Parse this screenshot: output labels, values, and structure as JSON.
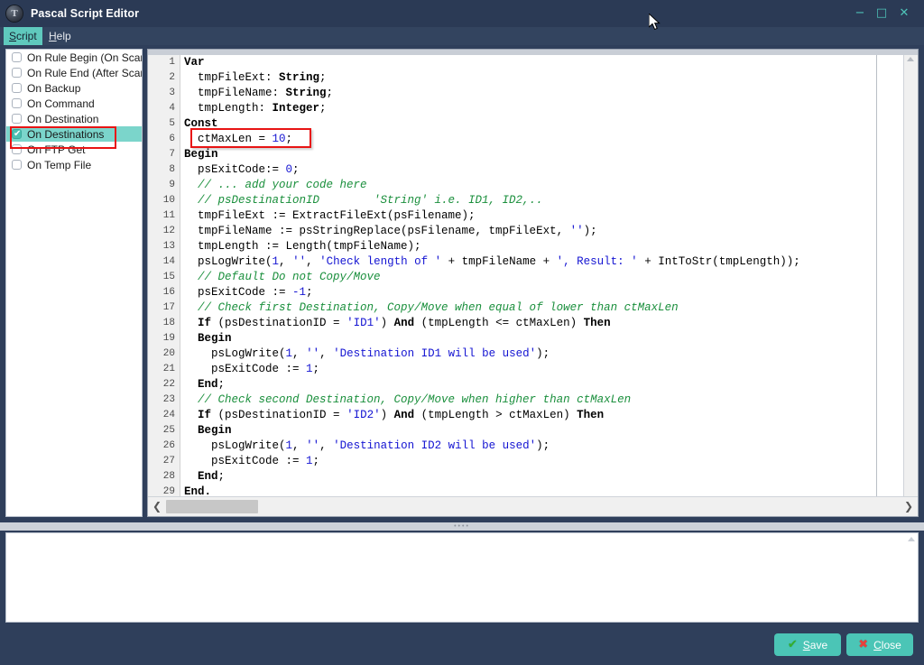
{
  "window": {
    "title": "Pascal Script Editor",
    "icon": "app-logo-icon",
    "minimize": "−",
    "maximize": "□",
    "close": "✕"
  },
  "menubar": {
    "items": [
      {
        "label": "Script",
        "accel": "S",
        "rest": "cript",
        "active": true
      },
      {
        "label": "Help",
        "accel": "H",
        "rest": "elp",
        "active": false
      }
    ]
  },
  "sidebar": {
    "items": [
      {
        "label": "On Rule Begin (On Scan)",
        "checked": false,
        "selected": false
      },
      {
        "label": "On Rule End (After Scan)",
        "checked": false,
        "selected": false
      },
      {
        "label": "On Backup",
        "checked": false,
        "selected": false
      },
      {
        "label": "On Command",
        "checked": false,
        "selected": false
      },
      {
        "label": "On Destination",
        "checked": false,
        "selected": false
      },
      {
        "label": "On Destinations",
        "checked": true,
        "selected": true
      },
      {
        "label": "On FTP Get",
        "checked": false,
        "selected": false
      },
      {
        "label": "On Temp File",
        "checked": false,
        "selected": false
      }
    ],
    "check_glyph": "✔"
  },
  "editor": {
    "line_numbers": [
      1,
      2,
      3,
      4,
      5,
      6,
      7,
      8,
      9,
      10,
      11,
      12,
      13,
      14,
      15,
      16,
      17,
      18,
      19,
      20,
      21,
      22,
      23,
      24,
      25,
      26,
      27,
      28,
      29
    ],
    "lines": [
      [
        {
          "t": "Var",
          "c": "kw"
        }
      ],
      [
        {
          "t": "  tmpFileExt: ",
          "c": "id"
        },
        {
          "t": "String",
          "c": "kw"
        },
        {
          "t": ";",
          "c": "op"
        }
      ],
      [
        {
          "t": "  tmpFileName: ",
          "c": "id"
        },
        {
          "t": "String",
          "c": "kw"
        },
        {
          "t": ";",
          "c": "op"
        }
      ],
      [
        {
          "t": "  tmpLength: ",
          "c": "id"
        },
        {
          "t": "Integer",
          "c": "kw"
        },
        {
          "t": ";",
          "c": "op"
        }
      ],
      [
        {
          "t": "Const",
          "c": "kw"
        }
      ],
      [
        {
          "t": "  ctMaxLen = ",
          "c": "id"
        },
        {
          "t": "10",
          "c": "num"
        },
        {
          "t": ";",
          "c": "op"
        }
      ],
      [
        {
          "t": "Begin",
          "c": "kw"
        }
      ],
      [
        {
          "t": "  psExitCode:= ",
          "c": "id"
        },
        {
          "t": "0",
          "c": "num"
        },
        {
          "t": ";",
          "c": "op"
        }
      ],
      [
        {
          "t": "  // ... add your code here",
          "c": "cmt"
        }
      ],
      [
        {
          "t": "  // psDestinationID        'String' i.e. ID1, ID2,..",
          "c": "cmt"
        }
      ],
      [
        {
          "t": "  tmpFileExt := ExtractFileExt(psFilename);",
          "c": "id"
        }
      ],
      [
        {
          "t": "  tmpFileName := psStringReplace(psFilename, tmpFileExt, ",
          "c": "id"
        },
        {
          "t": "''",
          "c": "str"
        },
        {
          "t": ");",
          "c": "op"
        }
      ],
      [
        {
          "t": "  tmpLength := Length(tmpFileName);",
          "c": "id"
        }
      ],
      [
        {
          "t": "  psLogWrite(",
          "c": "id"
        },
        {
          "t": "1",
          "c": "num"
        },
        {
          "t": ", ",
          "c": "op"
        },
        {
          "t": "''",
          "c": "str"
        },
        {
          "t": ", ",
          "c": "op"
        },
        {
          "t": "'Check length of '",
          "c": "str"
        },
        {
          "t": " + ",
          "c": "op"
        },
        {
          "t": "tmpFileName",
          "c": "id"
        },
        {
          "t": " + ",
          "c": "op"
        },
        {
          "t": "', Result: '",
          "c": "str"
        },
        {
          "t": " + ",
          "c": "op"
        },
        {
          "t": "IntToStr(tmpLength));",
          "c": "id"
        }
      ],
      [
        {
          "t": "  // Default Do not Copy/Move",
          "c": "cmt"
        }
      ],
      [
        {
          "t": "  psExitCode := ",
          "c": "id"
        },
        {
          "t": "-1",
          "c": "num"
        },
        {
          "t": ";",
          "c": "op"
        }
      ],
      [
        {
          "t": "  // Check first Destination, Copy/Move when equal of lower than ctMaxLen",
          "c": "cmt"
        }
      ],
      [
        {
          "t": "  ",
          "c": "op"
        },
        {
          "t": "If",
          "c": "kw"
        },
        {
          "t": " (psDestinationID = ",
          "c": "id"
        },
        {
          "t": "'ID1'",
          "c": "str"
        },
        {
          "t": ") ",
          "c": "op"
        },
        {
          "t": "And",
          "c": "kw"
        },
        {
          "t": " (tmpLength <= ctMaxLen) ",
          "c": "id"
        },
        {
          "t": "Then",
          "c": "kw"
        }
      ],
      [
        {
          "t": "  ",
          "c": "op"
        },
        {
          "t": "Begin",
          "c": "kw"
        }
      ],
      [
        {
          "t": "    psLogWrite(",
          "c": "id"
        },
        {
          "t": "1",
          "c": "num"
        },
        {
          "t": ", ",
          "c": "op"
        },
        {
          "t": "''",
          "c": "str"
        },
        {
          "t": ", ",
          "c": "op"
        },
        {
          "t": "'Destination ID1 will be used'",
          "c": "str"
        },
        {
          "t": ");",
          "c": "op"
        }
      ],
      [
        {
          "t": "    psExitCode := ",
          "c": "id"
        },
        {
          "t": "1",
          "c": "num"
        },
        {
          "t": ";",
          "c": "op"
        }
      ],
      [
        {
          "t": "  ",
          "c": "op"
        },
        {
          "t": "End",
          "c": "kw"
        },
        {
          "t": ";",
          "c": "op"
        }
      ],
      [
        {
          "t": "  // Check second Destination, Copy/Move when higher than ctMaxLen",
          "c": "cmt"
        }
      ],
      [
        {
          "t": "  ",
          "c": "op"
        },
        {
          "t": "If",
          "c": "kw"
        },
        {
          "t": " (psDestinationID = ",
          "c": "id"
        },
        {
          "t": "'ID2'",
          "c": "str"
        },
        {
          "t": ") ",
          "c": "op"
        },
        {
          "t": "And",
          "c": "kw"
        },
        {
          "t": " (tmpLength > ctMaxLen) ",
          "c": "id"
        },
        {
          "t": "Then",
          "c": "kw"
        }
      ],
      [
        {
          "t": "  ",
          "c": "op"
        },
        {
          "t": "Begin",
          "c": "kw"
        }
      ],
      [
        {
          "t": "    psLogWrite(",
          "c": "id"
        },
        {
          "t": "1",
          "c": "num"
        },
        {
          "t": ", ",
          "c": "op"
        },
        {
          "t": "''",
          "c": "str"
        },
        {
          "t": ", ",
          "c": "op"
        },
        {
          "t": "'Destination ID2 will be used'",
          "c": "str"
        },
        {
          "t": ");",
          "c": "op"
        }
      ],
      [
        {
          "t": "    psExitCode := ",
          "c": "id"
        },
        {
          "t": "1",
          "c": "num"
        },
        {
          "t": ";",
          "c": "op"
        }
      ],
      [
        {
          "t": "  ",
          "c": "op"
        },
        {
          "t": "End",
          "c": "kw"
        },
        {
          "t": ";",
          "c": "op"
        }
      ],
      [
        {
          "t": "End.",
          "c": "kw"
        }
      ]
    ],
    "hscroll_left": "❮",
    "hscroll_right": "❯"
  },
  "output": {
    "text": ""
  },
  "footer": {
    "save": {
      "label": "Save",
      "accel": "S",
      "rest": "ave",
      "icon": "✔"
    },
    "close": {
      "label": "Close",
      "accel": "C",
      "rest": "lose",
      "icon": "✖"
    }
  },
  "annotations": {
    "sidebar_box": "highlight-on-destinations",
    "code_box": "highlight-ctmaxlen-const"
  },
  "colors": {
    "titlebar": "#2b3a55",
    "menubar": "#33445f",
    "accent_teal": "#4bc5b6",
    "selection_teal": "#7bd5cb",
    "annotation_red": "#e81414",
    "comment_green": "#1a8f3c",
    "string_blue": "#1414d2"
  }
}
